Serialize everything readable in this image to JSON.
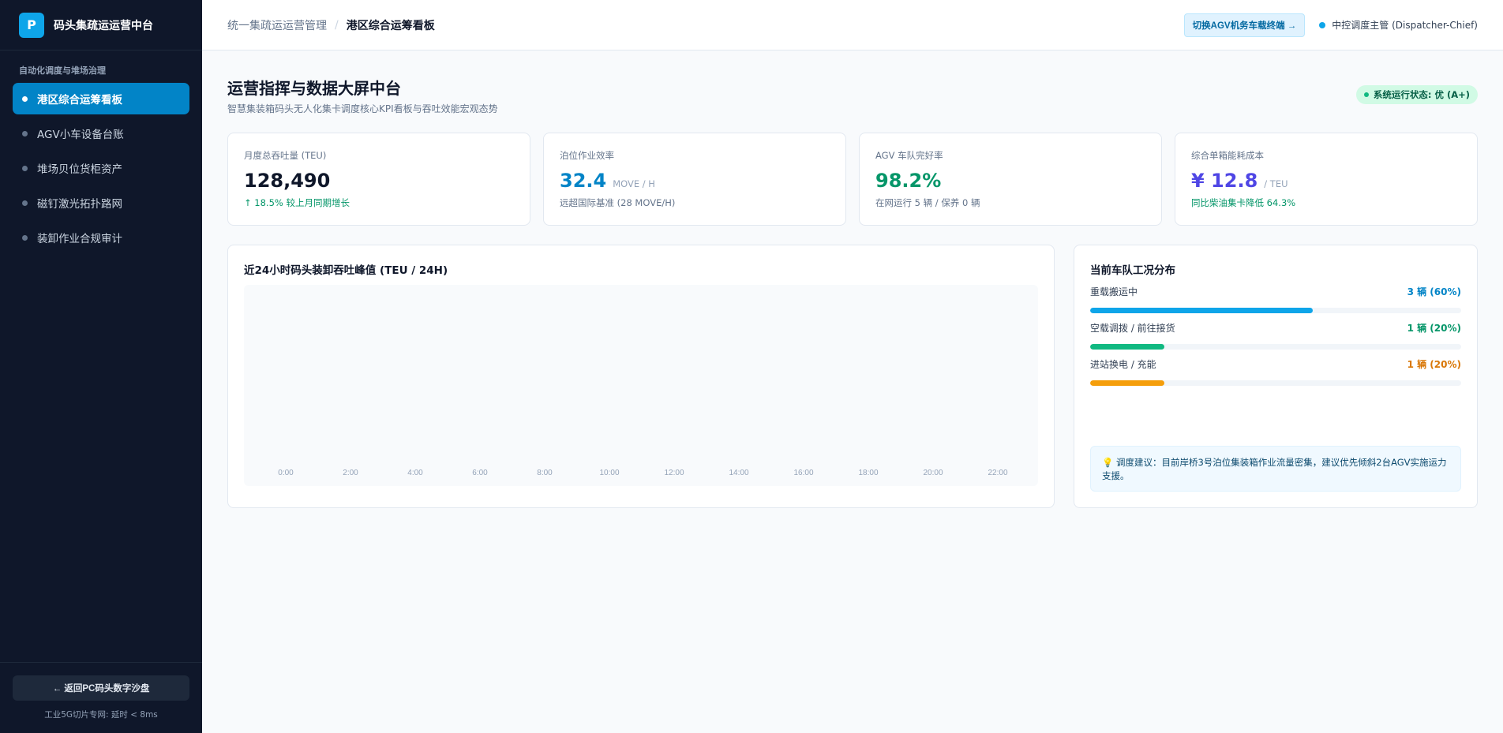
{
  "brand": {
    "logo": "P",
    "name": "码头集疏运运营中台"
  },
  "sidebar": {
    "section": "自动化调度与堆场治理",
    "items": [
      {
        "label": "港区综合运筹看板",
        "active": true
      },
      {
        "label": "AGV小车设备台账",
        "active": false
      },
      {
        "label": "堆场贝位货柜资产",
        "active": false
      },
      {
        "label": "磁钉激光拓扑路网",
        "active": false
      },
      {
        "label": "装卸作业合规审计",
        "active": false
      }
    ],
    "back_label": "← 返回PC码头数字沙盘",
    "network": "工业5G切片专网: 延时 < 8ms"
  },
  "header": {
    "crumb_root": "统一集疏运运营管理",
    "crumb_sep": "/",
    "crumb_current": "港区综合运筹看板",
    "switch_label": "切换AGV机务车载终端 →",
    "user": "中控调度主管 (Dispatcher-Chief)"
  },
  "page": {
    "title": "运营指挥与数据大屏中台",
    "subtitle": "智慧集装箱码头无人化集卡调度核心KPI看板与吞吐效能宏观态势",
    "status": "系统运行状态: 优 (A+)"
  },
  "kpis": [
    {
      "label": "月度总吞吐量 (TEU)",
      "value": "128,490",
      "unit": "",
      "note": "↑ 18.5% 较上月同期增长",
      "value_color": "#0f172a",
      "note_color": "#059669"
    },
    {
      "label": "泊位作业效率",
      "value": "32.4",
      "unit": "MOVE / H",
      "note": "远超国际基准 (28 MOVE/H)",
      "value_color": "#0284c7",
      "note_color": "#64748b"
    },
    {
      "label": "AGV 车队完好率",
      "value": "98.2%",
      "unit": "",
      "note": "在网运行 5 辆 / 保养 0 辆",
      "value_color": "#059669",
      "note_color": "#64748b"
    },
    {
      "label": "综合单箱能耗成本",
      "value": "¥ 12.8",
      "unit": "/ TEU",
      "note": "同比柴油集卡降低 64.3%",
      "value_color": "#4f46e5",
      "note_color": "#059669"
    }
  ],
  "chart": {
    "title": "近24小时码头装卸吞吐峰值 (TEU / 24H)"
  },
  "chart_data": {
    "type": "bar",
    "categories": [
      "0:00",
      "2:00",
      "4:00",
      "6:00",
      "8:00",
      "10:00",
      "12:00",
      "14:00",
      "16:00",
      "18:00",
      "20:00",
      "22:00"
    ],
    "values": [],
    "title": "近24小时码头装卸吞吐峰值 (TEU / 24H)",
    "grid": false
  },
  "fleet": {
    "title": "当前车队工况分布",
    "rows": [
      {
        "label": "重载搬运中",
        "value": "3 辆 (60%)",
        "fraction": 0.6,
        "color": "#0ea5e9",
        "text_color": "#0284c7"
      },
      {
        "label": "空载调拨 / 前往接货",
        "value": "1 辆 (20%)",
        "fraction": 0.2,
        "color": "#10b981",
        "text_color": "#059669"
      },
      {
        "label": "进站换电 / 充能",
        "value": "1 辆 (20%)",
        "fraction": 0.2,
        "color": "#f59e0b",
        "text_color": "#d97706"
      }
    ],
    "advice": "💡 调度建议：目前岸桥3号泊位集装箱作业流量密集，建议优先倾斜2台AGV实施运力支援。"
  }
}
